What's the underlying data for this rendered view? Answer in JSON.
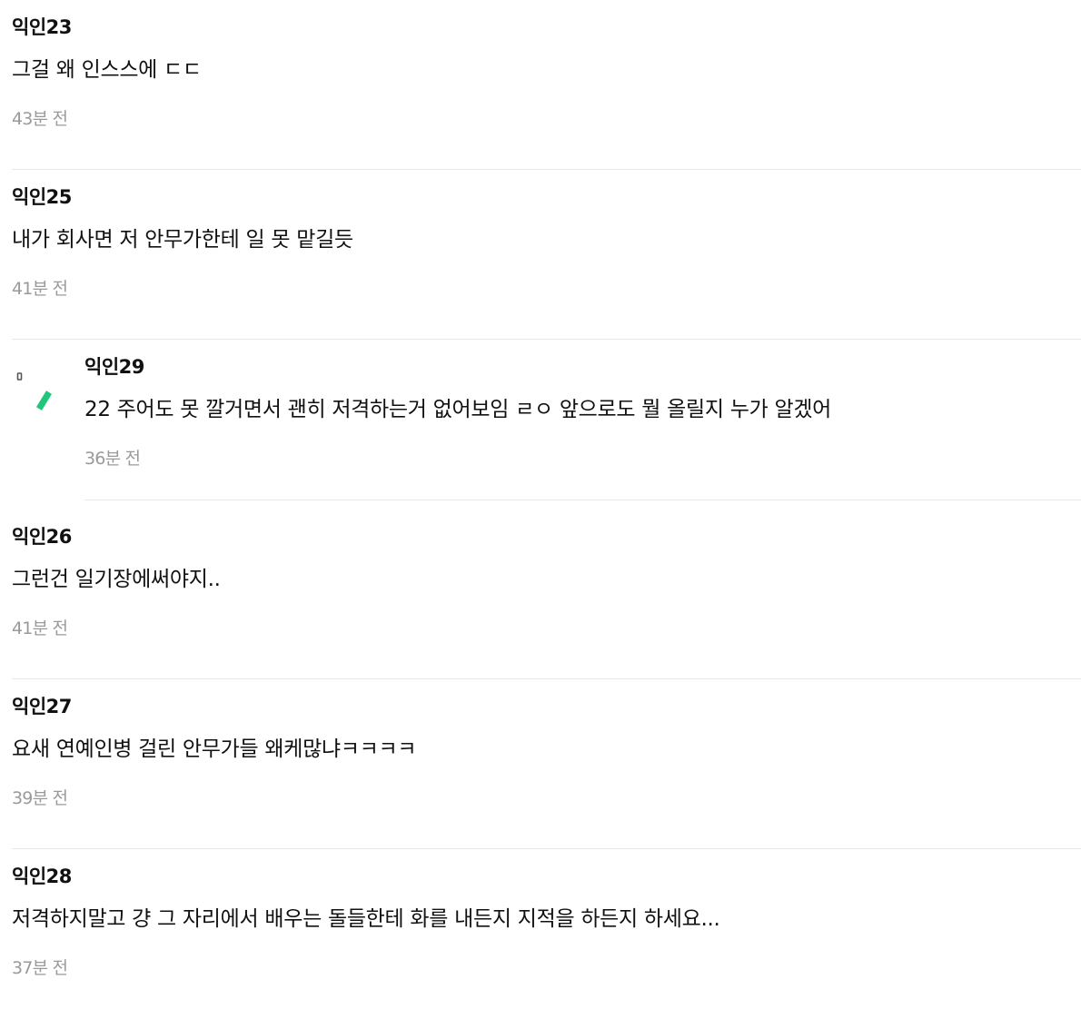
{
  "comments": [
    {
      "author": "익인23",
      "body": "그걸 왜 인스스에 ㄷㄷ",
      "time": "43분 전"
    },
    {
      "author": "익인25",
      "body": "내가 회사면 저 안무가한테 일 못 맡길듯",
      "time": "41분 전"
    },
    {
      "author": "익인29",
      "body": "22 주어도 못 깔거면서 괜히 저격하는거 없어보임 ㄹㅇ 앞으로도 뭘 올릴지 누가 알겠어",
      "time": "36분 전",
      "is_reply": true
    },
    {
      "author": "익인26",
      "body": "그런건 일기장에써야지..",
      "time": "41분 전"
    },
    {
      "author": "익인27",
      "body": "요새 연예인병 걸린 안무가들 왜케많냐ㅋㅋㅋㅋ",
      "time": "39분 전"
    },
    {
      "author": "익인28",
      "body": "저격하지말고 걍 그 자리에서 배우는 돌들한테 화를 내든지 지적을 하든지 하세요...",
      "time": "37분 전"
    }
  ],
  "colors": {
    "text": "#111111",
    "time": "#9a9a9a",
    "divider": "#e6e6e6",
    "reply_accent": "#1fc77a"
  },
  "icons": {
    "reply_marker": "reply-arrow-icon"
  }
}
